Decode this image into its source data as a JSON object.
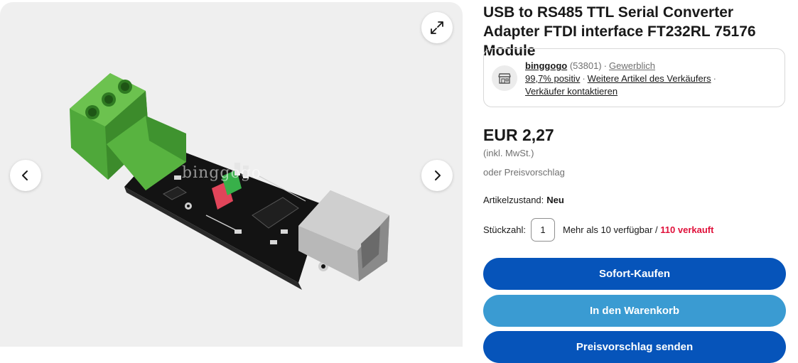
{
  "gallery": {
    "watermark": "binggogo",
    "icons": {
      "expand": "expand-icon",
      "prev": "chevron-left-icon",
      "next": "chevron-right-icon"
    }
  },
  "product": {
    "title": "USB to RS485 TTL Serial Converter Adapter FTDI interface FT232RL 75176 Module"
  },
  "seller": {
    "name": "binggogo",
    "feedback_count": "(53801)",
    "type": "Gewerblich",
    "positive": "99,7% positiv",
    "more_items": "Weitere Artikel des Verkäufers",
    "contact": "Verkäufer kontaktieren",
    "icon": "store-icon"
  },
  "price": {
    "amount": "EUR 2,27",
    "vat_note": "(inkl. MwSt.)",
    "offer_note": "oder Preisvorschlag"
  },
  "condition": {
    "label": "Artikelzustand:",
    "value": "Neu"
  },
  "quantity": {
    "label": "Stückzahl:",
    "value": "1",
    "available": "Mehr als 10 verfügbar /",
    "sold": "110 verkauft"
  },
  "actions": {
    "buy_now": "Sofort-Kaufen",
    "add_to_cart": "In den Warenkorb",
    "make_offer": "Preisvorschlag senden"
  },
  "colors": {
    "primary": "#0654ba",
    "secondary": "#3a9bd2",
    "sold_red": "#e0103a"
  }
}
